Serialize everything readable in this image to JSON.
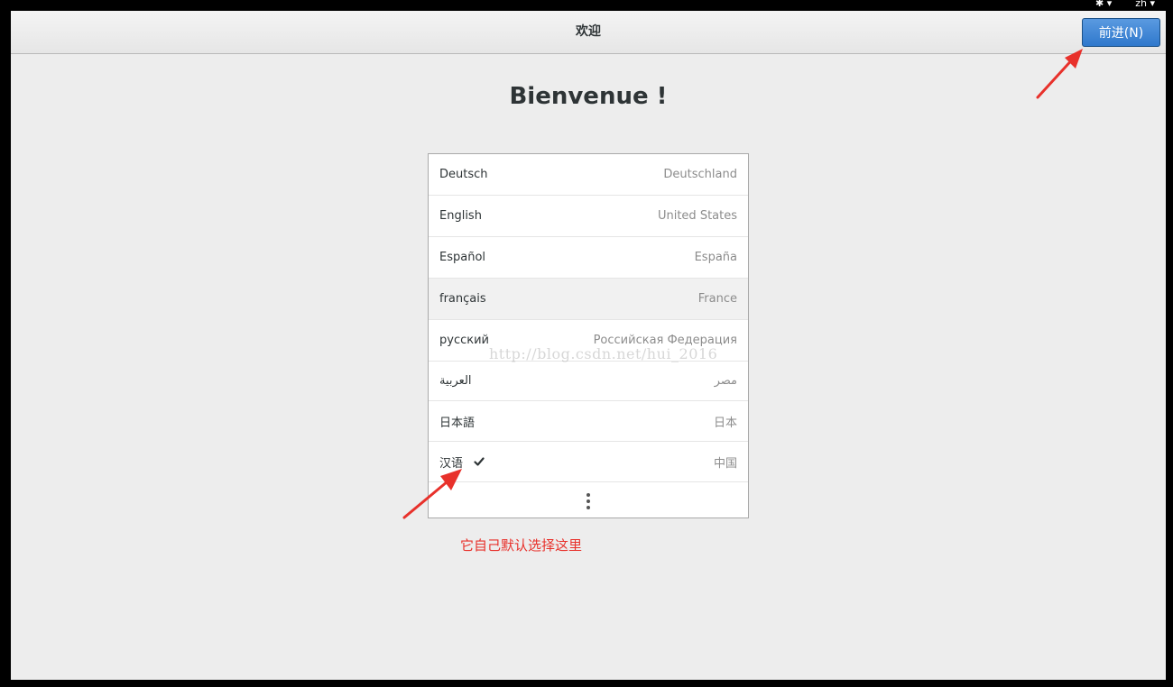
{
  "window": {
    "title": "欢迎",
    "next_button_label": "前进(N)"
  },
  "page": {
    "heading": "Bienvenue !"
  },
  "languages": [
    {
      "name": "Deutsch",
      "region": "Deutschland"
    },
    {
      "name": "English",
      "region": "United States"
    },
    {
      "name": "Español",
      "region": "España"
    },
    {
      "name": "français",
      "region": "France"
    },
    {
      "name": "русский",
      "region": "Российская Федерация"
    },
    {
      "name": "العربية",
      "region": "مصر"
    },
    {
      "name": "日本語",
      "region": "日本"
    },
    {
      "name": "汉语",
      "region": "中国"
    }
  ],
  "selected_language": "汉语",
  "icons": {
    "check": "check-icon",
    "more": "more-vertical-icon",
    "topbar_accessibility": "accessibility-icon",
    "topbar_dropdown": "chevron-down-icon"
  },
  "watermark": "http://blog.csdn.net/hui_2016",
  "annotation": {
    "text": "它自己默认选择这里",
    "color": "#e8312b"
  },
  "colors": {
    "accent_button": "#2f78cc",
    "annotation_red": "#e8312b"
  }
}
